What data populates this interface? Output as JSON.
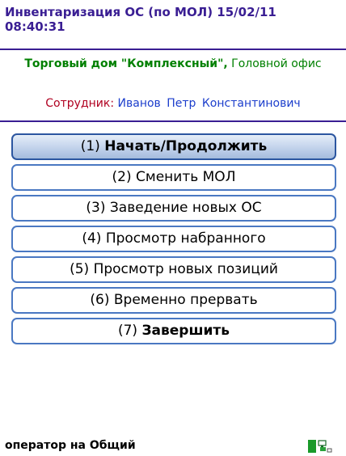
{
  "header": {
    "title_line1": "Инвентаризация ОС (по МОЛ) 15/02/11",
    "title_line2": "08:40:31"
  },
  "org": {
    "company": "Торговый дом \"Комплексный\",",
    "office": "Головной офис"
  },
  "employee": {
    "label": "Сотрудник:",
    "name": "Иванов Петр Константинович"
  },
  "menu": [
    {
      "num": "(1)",
      "text": "Начать/Продолжить"
    },
    {
      "num": "(2)",
      "text": "Сменить МОЛ"
    },
    {
      "num": "(3)",
      "text": "Заведение новых ОС"
    },
    {
      "num": "(4)",
      "text": "Просмотр набранного"
    },
    {
      "num": "(5)",
      "text": "Просмотр новых позиций"
    },
    {
      "num": "(6)",
      "text": "Временно прервать"
    },
    {
      "num": "(7)",
      "text": "Завершить"
    }
  ],
  "status": {
    "text": "оператор на Общий",
    "signal_icon": "signal-icon",
    "network_icon": "network-icon"
  },
  "colors": {
    "header": "#3a1e93",
    "company": "#008000",
    "employee_label": "#b00020",
    "employee_name": "#1c3ecc",
    "button_border": "#4a78c2"
  }
}
